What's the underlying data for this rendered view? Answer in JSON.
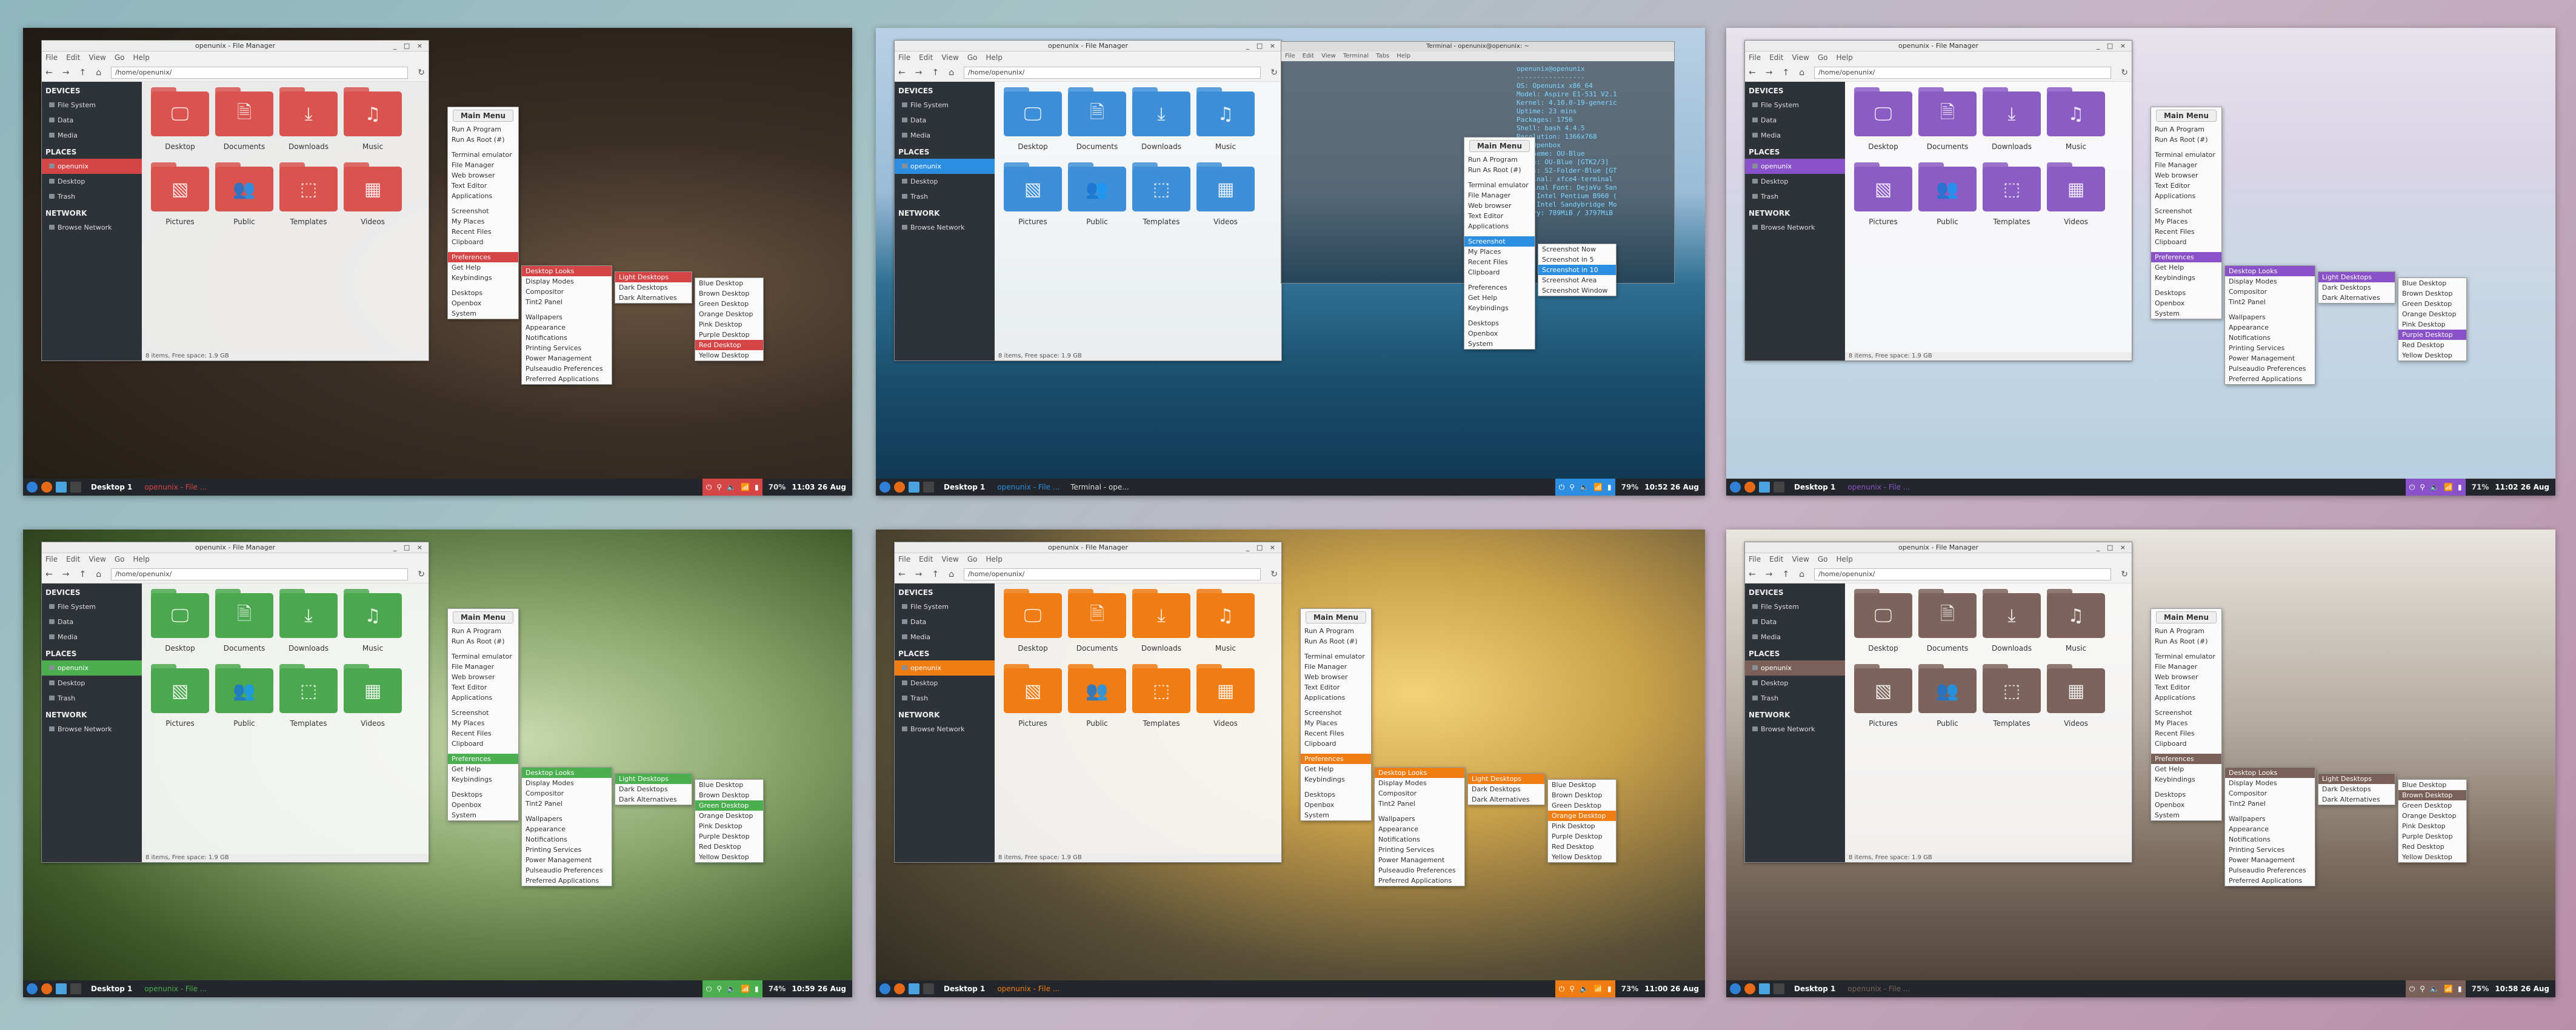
{
  "shots": [
    {
      "theme": "red",
      "accent": "#d64545",
      "folder": "#d9534f",
      "sel_sidebar": "#d64545",
      "wall": "w-red",
      "time": "11:03 26 Aug",
      "battery": "70%",
      "task": "openunix - File ...",
      "task2": "",
      "sub_hl": "Red Desktop"
    },
    {
      "theme": "blue",
      "accent": "#2b8ee0",
      "folder": "#3f8fd8",
      "sel_sidebar": "#2b8ee0",
      "wall": "w-blue",
      "time": "10:52 26 Aug",
      "battery": "79%",
      "task": "openunix - File ...",
      "task2": "Terminal - ope...",
      "sub_hl": ""
    },
    {
      "theme": "purple",
      "accent": "#8a52c8",
      "folder": "#8b5cc4",
      "sel_sidebar": "#8a52c8",
      "wall": "w-purple",
      "time": "11:02 26 Aug",
      "battery": "71%",
      "task": "openunix - File ...",
      "task2": "",
      "sub_hl": "Purple Desktop"
    },
    {
      "theme": "green",
      "accent": "#4bae4f",
      "folder": "#4ba84f",
      "sel_sidebar": "#4bae4f",
      "wall": "w-green",
      "time": "10:59 26 Aug",
      "battery": "74%",
      "task": "openunix - File ...",
      "task2": "",
      "sub_hl": "Green Desktop"
    },
    {
      "theme": "orange",
      "accent": "#ef7d12",
      "folder": "#f07d14",
      "sel_sidebar": "#ef7d12",
      "wall": "w-orange",
      "time": "11:00 26 Aug",
      "battery": "73%",
      "task": "openunix - File ...",
      "task2": "",
      "sub_hl": "Orange Desktop"
    },
    {
      "theme": "brown",
      "accent": "#7a6058",
      "folder": "#7c645c",
      "sel_sidebar": "#7a6058",
      "wall": "w-brown",
      "time": "10:58 26 Aug",
      "battery": "75%",
      "task": "openunix - File ...",
      "task2": "",
      "sub_hl": "Brown Desktop"
    }
  ],
  "fm": {
    "title": "openunix - File Manager",
    "menubar": [
      "File",
      "Edit",
      "View",
      "Go",
      "Help"
    ],
    "path": "/home/openunix/",
    "devices_hd": "DEVICES",
    "devices": [
      "File System",
      "Data",
      "Media"
    ],
    "places_hd": "PLACES",
    "places": [
      "openunix",
      "Desktop",
      "Trash"
    ],
    "network_hd": "NETWORK",
    "network": [
      "Browse Network"
    ],
    "items": [
      "Desktop",
      "Documents",
      "Downloads",
      "Music",
      "Pictures",
      "Public",
      "Templates",
      "Videos"
    ],
    "status": "8 items, Free space: 1.9 GB"
  },
  "main_menu": {
    "title": "Main Menu",
    "group1": [
      "Run A Program",
      "Run As Root (#)"
    ],
    "group2": [
      "Terminal emulator",
      "File Manager",
      "Web browser",
      "Text Editor",
      "Applications"
    ],
    "group3": [
      "Screenshot",
      "My Places",
      "Recent Files",
      "Clipboard"
    ],
    "group4": [
      "Preferences",
      "Get Help",
      "Keybindings"
    ],
    "group5": [
      "Desktops",
      "Openbox",
      "System"
    ]
  },
  "pref_menu": {
    "group1": [
      "Desktop Looks",
      "Display Modes",
      "Compositor",
      "Tint2 Panel"
    ],
    "group2": [
      "Wallpapers",
      "Appearance",
      "Notifications",
      "Printing Services",
      "Power Management",
      "Pulseaudio Preferences",
      "Preferred Applications"
    ]
  },
  "looks_menu": [
    "Light Desktops",
    "Dark Desktops",
    "Dark Alternatives"
  ],
  "colors_menu": [
    "Blue Desktop",
    "Brown Desktop",
    "Green Desktop",
    "Orange Desktop",
    "Pink Desktop",
    "Purple Desktop",
    "Red Desktop",
    "Yellow Desktop"
  ],
  "screenshot_menu": [
    "Screenshot Now",
    "Screenshot in 5",
    "Screenshot in 10",
    "Screenshot Area",
    "Screenshot Window"
  ],
  "terminal": {
    "title": "Terminal - openunix@openunix: ~",
    "menubar": [
      "File",
      "Edit",
      "View",
      "Terminal",
      "Tabs",
      "Help"
    ],
    "info": "openunix@openunix\n-----------------\nOS: Openunix x86_64\nModel: Aspire E1-531 V2.1\nKernel: 4.10.0-19-generic\nUptime: 23 mins\nPackages: 1756\nShell: bash 4.4.5\nResolution: 1366x768\nWM: Openbox\nWM Theme: OU-Blue\nTheme: OU-Blue [GTK2/3]\nIcons: S2-Folder-Blue [GT\nTerminal: xfce4-terminal\nTerminal Font: DejaVu San\nCPU: Intel Pentium B960 (\nGPU: Intel Sandybridge Mo\nMemory: 789MiB / 3797MiB"
  },
  "panel": {
    "desktop": "Desktop 1"
  }
}
